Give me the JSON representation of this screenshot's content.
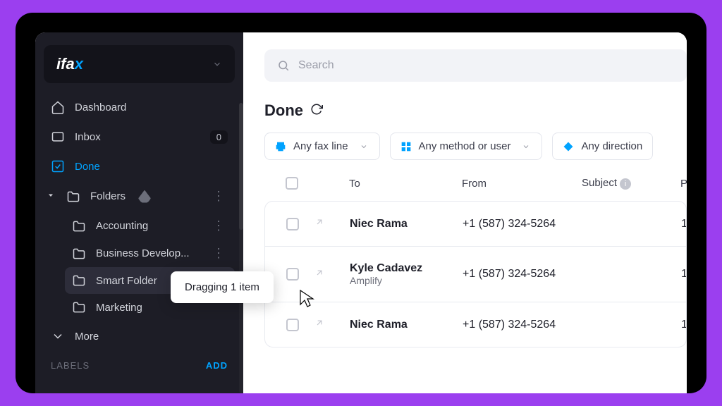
{
  "brand": "ifax",
  "search": {
    "placeholder": "Search"
  },
  "sidebar": {
    "items": [
      {
        "label": "Dashboard"
      },
      {
        "label": "Inbox",
        "badge": "0"
      },
      {
        "label": "Done"
      }
    ],
    "folders_label": "Folders",
    "folders": [
      {
        "label": "Accounting"
      },
      {
        "label": "Business Develop..."
      },
      {
        "label": "Smart Folder"
      },
      {
        "label": "Marketing"
      }
    ],
    "more_label": "More",
    "labels_header": "LABELS",
    "add_label": "ADD"
  },
  "page_title": "Done",
  "filters": {
    "fax_line": "Any fax line",
    "method": "Any method or user",
    "direction": "Any direction"
  },
  "table": {
    "headers": {
      "to": "To",
      "from": "From",
      "subject": "Subject",
      "pages": "Pages"
    },
    "rows": [
      {
        "to": "Niec Rama",
        "to_sub": "",
        "from": "+1 (587) 324-5264",
        "pages": "1"
      },
      {
        "to": "Kyle Cadavez",
        "to_sub": "Amplify",
        "from": "+1 (587) 324-5264",
        "pages": "1"
      },
      {
        "to": "Niec Rama",
        "to_sub": "",
        "from": "+1 (587) 324-5264",
        "pages": "1"
      }
    ]
  },
  "drag_tooltip": "Dragging 1 item"
}
